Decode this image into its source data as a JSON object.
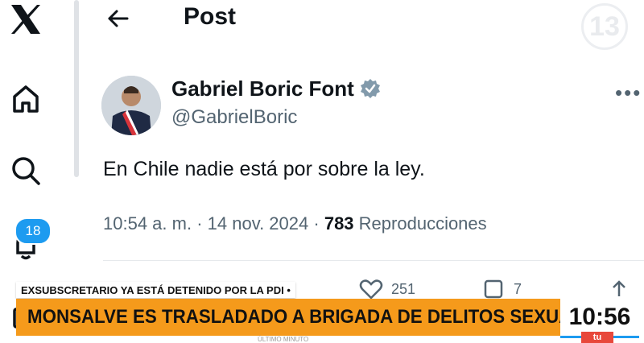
{
  "sidebar": {
    "icons": [
      "x-logo-icon",
      "home-icon",
      "search-icon",
      "notifications-icon",
      "mail-icon"
    ],
    "notification_count": "18"
  },
  "header": {
    "title": "Post",
    "back_icon": "arrow-left-icon",
    "channel_logo": "13"
  },
  "post": {
    "author_name": "Gabriel Boric Font",
    "author_handle": "@GabrielBoric",
    "verified_icon": "verified-badge-icon",
    "text": "En Chile nadie está por sobre la ley.",
    "time": "10:54 a. m.",
    "separator": "·",
    "date": "14 nov. 2024",
    "views_count": "783",
    "views_label": "Reproducciones",
    "more_icon": "more-dots-icon",
    "actions": {
      "like_count": "251",
      "repost_count": "7"
    }
  },
  "broadcast": {
    "ticker_top": "EXSUBSCRETARIO YA ESTÁ DETENIDO POR LA PDI •",
    "headline": "MONSALVE ES TRASLADADO A BRIGADA DE DELITOS SEXUALES",
    "clock": "10:56",
    "bottom_strip": "ÚLTIMO MINUTO",
    "live_logo": "tu",
    "colors": {
      "headline_bg": "#f59a1b",
      "accent": "#1d9bf0"
    }
  }
}
